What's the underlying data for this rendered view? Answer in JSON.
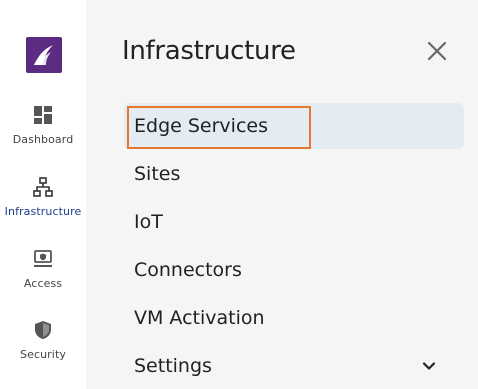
{
  "rail": {
    "items": [
      {
        "label": "Dashboard",
        "icon": "dashboard-icon"
      },
      {
        "label": "Infrastructure",
        "icon": "infrastructure-icon",
        "active": true
      },
      {
        "label": "Access",
        "icon": "access-icon"
      },
      {
        "label": "Security",
        "icon": "security-icon"
      }
    ]
  },
  "panel": {
    "title": "Infrastructure",
    "items": [
      {
        "label": "Edge Services",
        "selected": true
      },
      {
        "label": "Sites"
      },
      {
        "label": "IoT"
      },
      {
        "label": "Connectors"
      },
      {
        "label": "VM Activation"
      },
      {
        "label": "Settings",
        "expandable": true
      }
    ]
  },
  "colors": {
    "brand": "#5b2c82",
    "active_text": "#1a3e8c",
    "selected_bg": "#e3ebf3",
    "highlight": "#e8772e"
  }
}
